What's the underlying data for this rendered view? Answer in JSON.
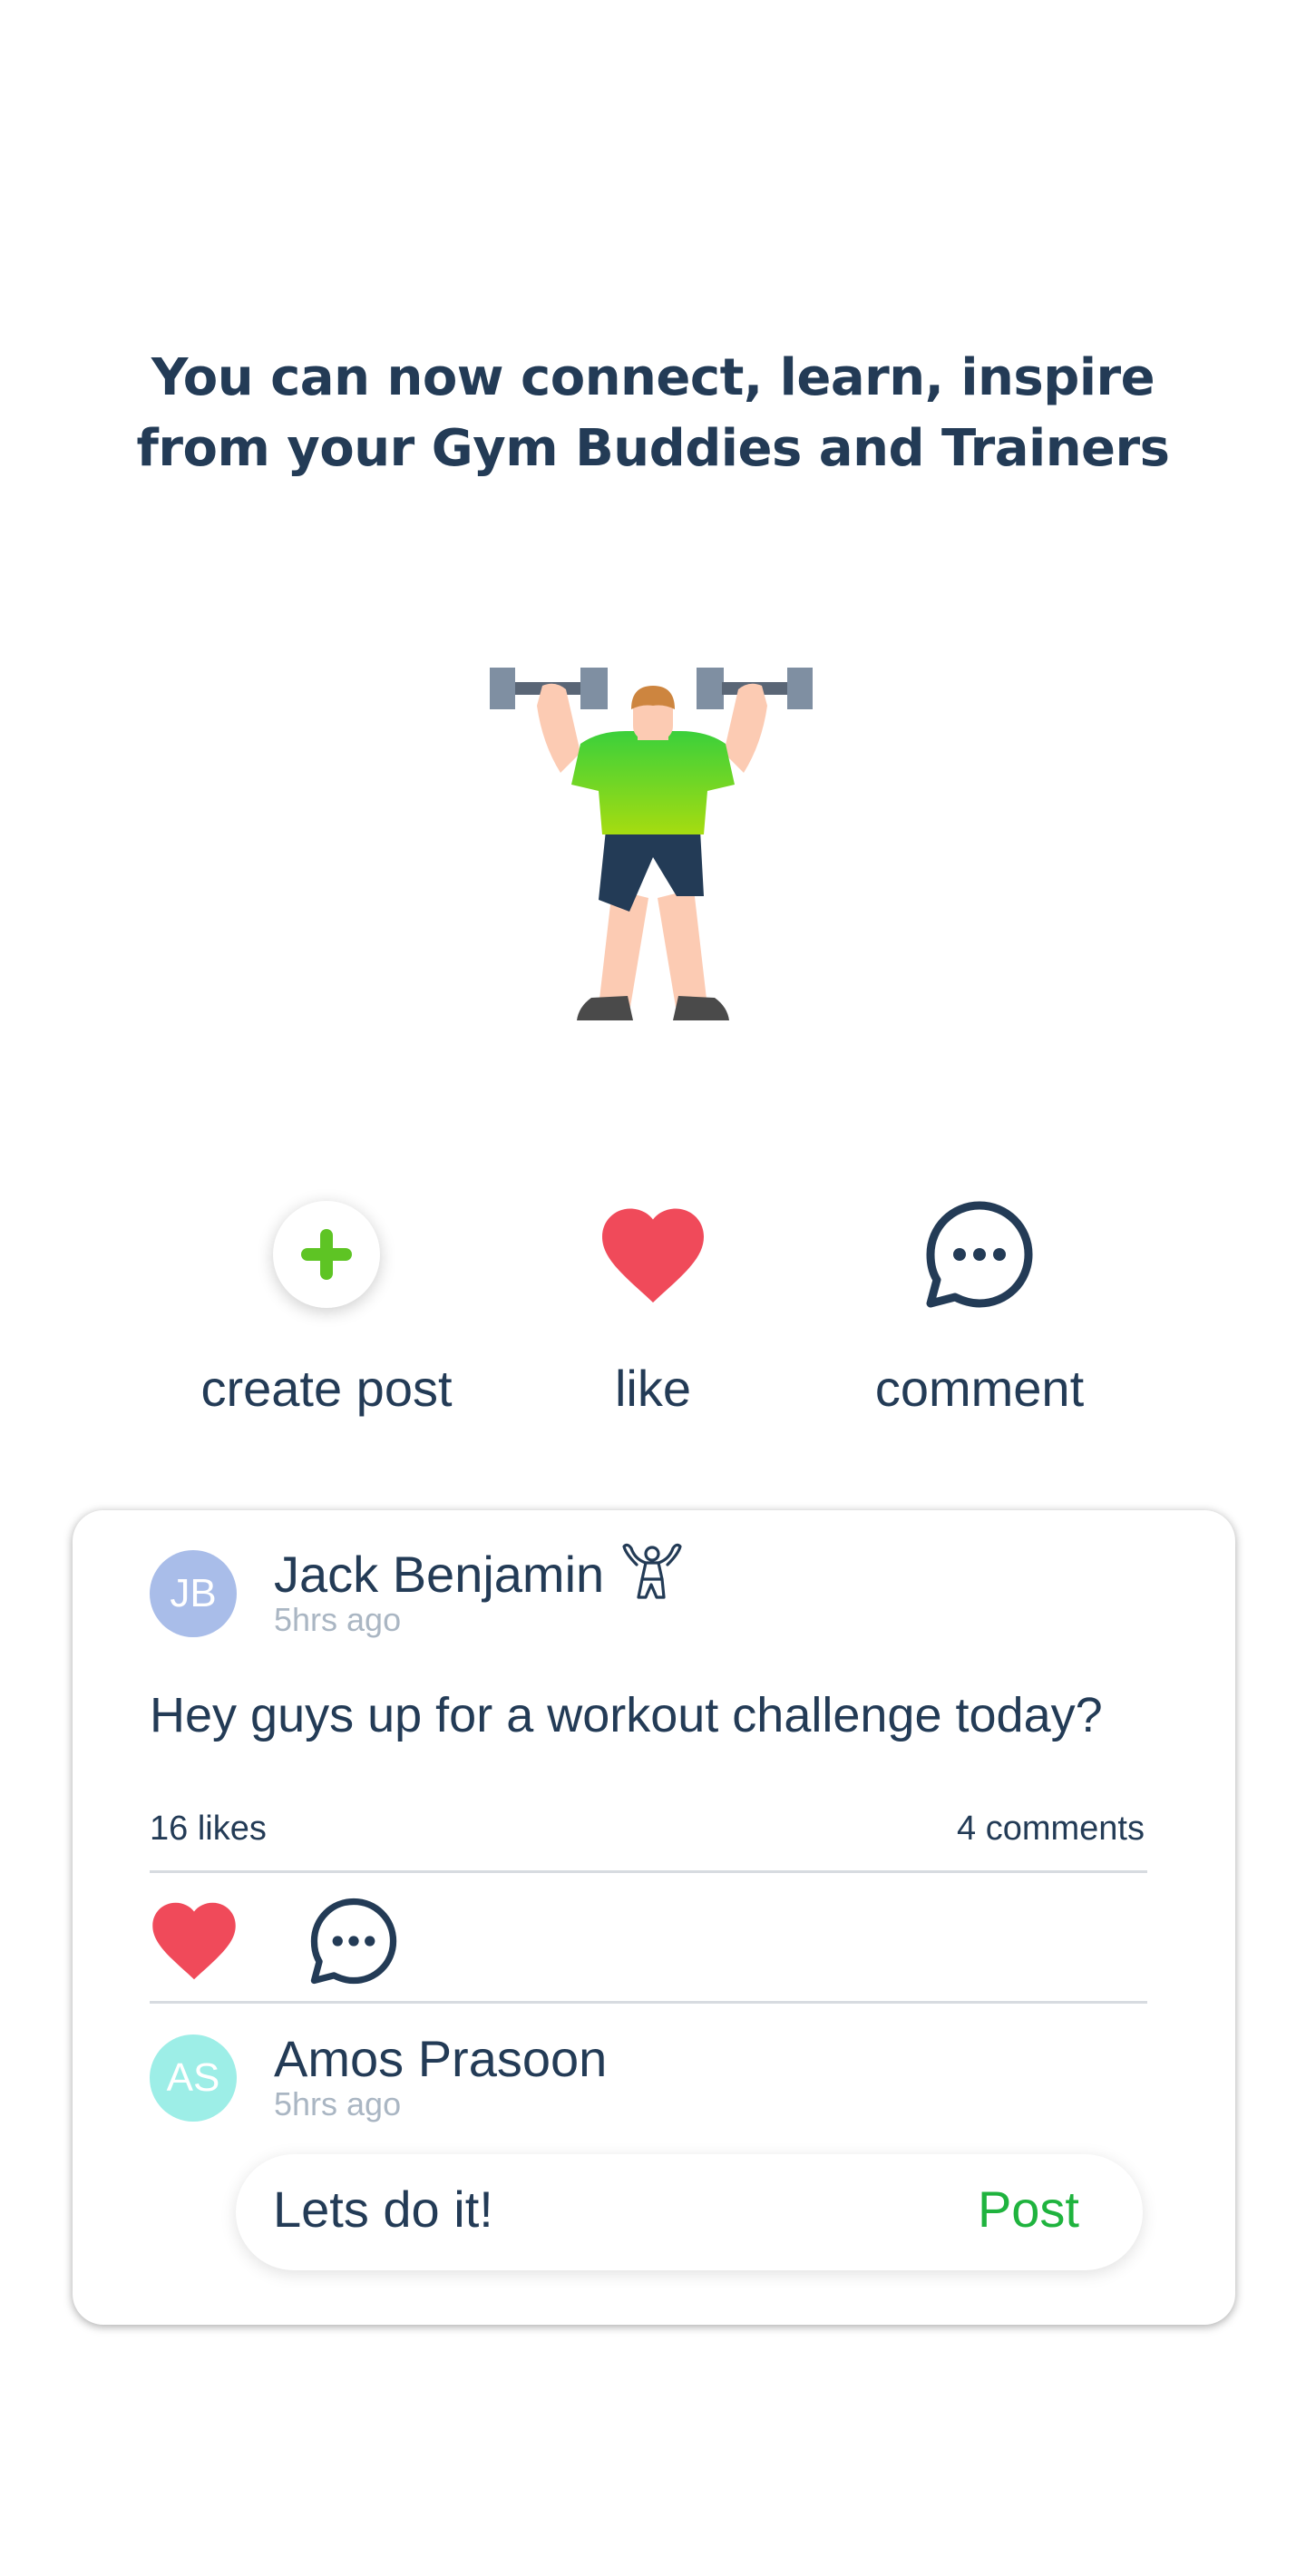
{
  "headline": {
    "line1": "You can now connect, learn, inspire",
    "line2": "from your Gym Buddies and Trainers"
  },
  "illustration": {
    "icon": "weightlifter-illustration"
  },
  "actions": [
    {
      "label": "create post",
      "icon": "plus-icon",
      "color": "#5ec424"
    },
    {
      "label": "like",
      "icon": "heart-icon",
      "color": "#f04a5a"
    },
    {
      "label": "comment",
      "icon": "speech-bubble-icon",
      "color": "#233b56"
    }
  ],
  "post": {
    "author": {
      "initials": "JB",
      "name": "Jack Benjamin",
      "time": "5hrs ago",
      "avatar_color": "#a9bde9",
      "badge_icon": "bodybuilder-icon"
    },
    "text": "Hey guys up for a workout challenge today?",
    "likes": "16 likes",
    "comments": "4 comments",
    "reply": {
      "author": {
        "initials": "AS",
        "name": "Amos Prasoon",
        "time": "5hrs ago",
        "avatar_color": "#9deee7"
      },
      "input_value": "Lets do it!",
      "post_label": "Post",
      "post_color": "#1fb33e"
    }
  }
}
